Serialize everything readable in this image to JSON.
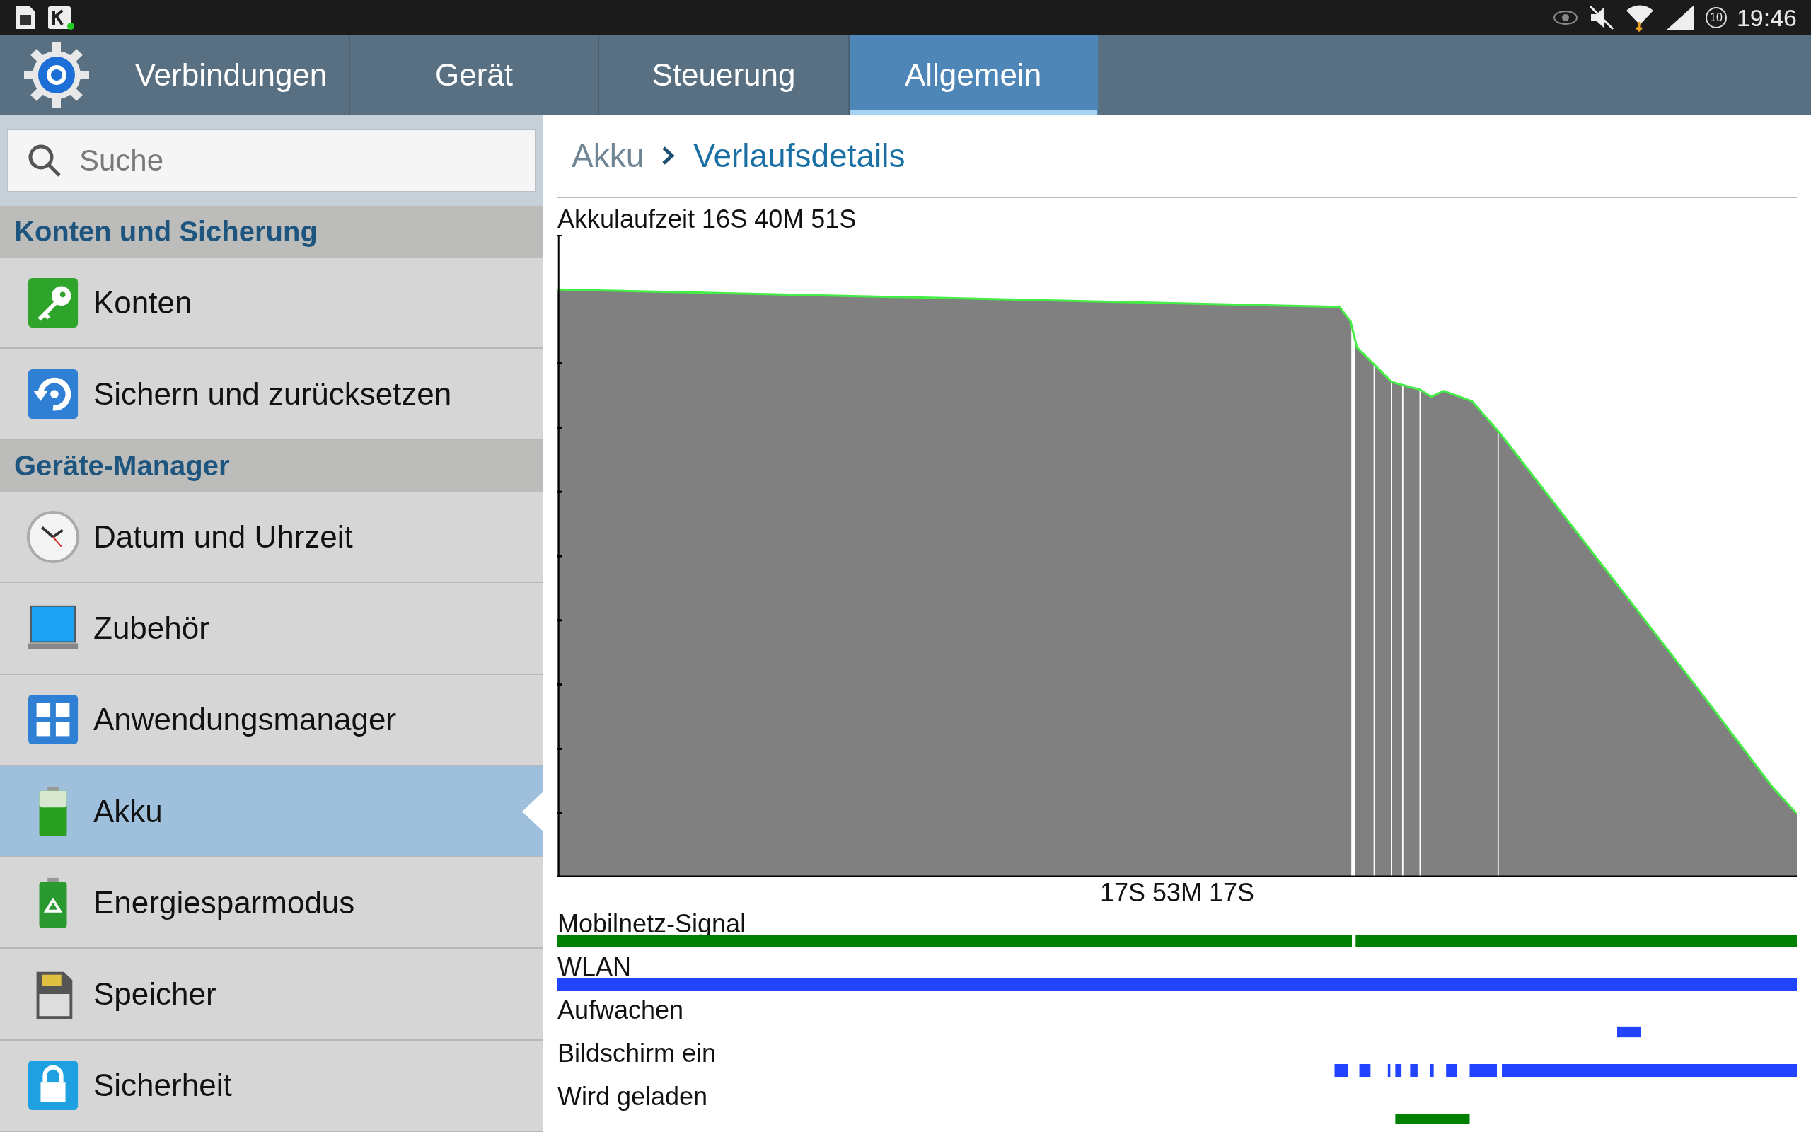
{
  "status_bar": {
    "badge": "10",
    "time": "19:46"
  },
  "tabs": [
    {
      "label": "Verbindungen",
      "selected": false
    },
    {
      "label": "Gerät",
      "selected": false
    },
    {
      "label": "Steuerung",
      "selected": false
    },
    {
      "label": "Allgemein",
      "selected": true
    }
  ],
  "search": {
    "placeholder": "Suche"
  },
  "sidebar": {
    "items": [
      {
        "kind": "section",
        "label": "Konten und Sicherung"
      },
      {
        "kind": "item",
        "label": "Konten",
        "selected": false
      },
      {
        "kind": "item",
        "label": "Sichern und zurücksetzen",
        "selected": false
      },
      {
        "kind": "section",
        "label": "Geräte-Manager"
      },
      {
        "kind": "item",
        "label": "Datum und Uhrzeit",
        "selected": false
      },
      {
        "kind": "item",
        "label": "Zubehör",
        "selected": false
      },
      {
        "kind": "item",
        "label": "Anwendungsmanager",
        "selected": false
      },
      {
        "kind": "item",
        "label": "Akku",
        "selected": true
      },
      {
        "kind": "item",
        "label": "Energiesparmodus",
        "selected": false
      },
      {
        "kind": "item",
        "label": "Speicher",
        "selected": false
      },
      {
        "kind": "item",
        "label": "Sicherheit",
        "selected": false
      }
    ]
  },
  "breadcrumb": [
    "Akku",
    "Verlaufsdetails"
  ],
  "battery_graph": {
    "title": "Akkulaufzeit 16S 40M 51S",
    "duration": "17S 53M 17S"
  },
  "timelines": [
    {
      "label": "Mobilnetz-Signal",
      "color": "#008000"
    },
    {
      "label": "WLAN",
      "color": "#2244ff"
    },
    {
      "label": "Aufwachen",
      "color": "#2244ff"
    },
    {
      "label": "Bildschirm ein",
      "color": "#2244ff"
    },
    {
      "label": "Wird geladen",
      "color": "#008000"
    }
  ]
}
